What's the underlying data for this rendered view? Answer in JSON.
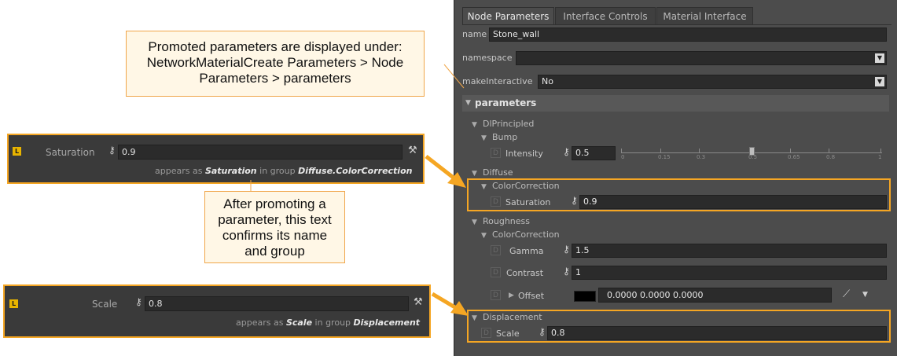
{
  "tabs": [
    "Node Parameters",
    "Interface Controls",
    "Material Interface"
  ],
  "name_field": {
    "label": "name",
    "value": "Stone_wall"
  },
  "namespace_field": {
    "label": "namespace",
    "value": ""
  },
  "make_interactive": {
    "label": "makeInteractive",
    "value": "No"
  },
  "section_title": "parameters",
  "tree": {
    "dlprincipled": "DlPrincipled",
    "bump": "Bump",
    "intensity": {
      "label": "Intensity",
      "value": "0.5"
    },
    "slider_ticks": [
      "0",
      "0.15",
      "0.3",
      "0.5",
      "0.65",
      "0.8",
      "1"
    ],
    "slider_value": 0.5,
    "diffuse": "Diffuse",
    "diffuse_cc": "ColorCorrection",
    "saturation": {
      "label": "Saturation",
      "value": "0.9"
    },
    "roughness": "Roughness",
    "roughness_cc": "ColorCorrection",
    "gamma": {
      "label": "Gamma",
      "value": "1.5"
    },
    "contrast": {
      "label": "Contrast",
      "value": "1"
    },
    "offset": {
      "label": "Offset",
      "value": "0.0000  0.0000  0.0000",
      "swatch": "#000000"
    },
    "displacement": "Displacement",
    "scale": {
      "label": "Scale",
      "value": "0.8"
    }
  },
  "left_bar_1": {
    "icon": "L",
    "label": "Saturation",
    "value": "0.9",
    "appears_prefix": "appears as",
    "appears_name": "Saturation",
    "appears_mid": "in group",
    "appears_group": "Diffuse.ColorCorrection"
  },
  "left_bar_2": {
    "icon": "L",
    "label": "Scale",
    "value": "0.8",
    "appears_prefix": "appears as",
    "appears_name": "Scale",
    "appears_mid": "in group",
    "appears_group": "Displacement"
  },
  "callout_top": [
    "Promoted parameters are displayed under:",
    "NetworkMaterialCreate Parameters > Node",
    "Parameters > parameters"
  ],
  "callout_mid": [
    "After promoting a",
    "parameter, this text",
    "confirms its name",
    "and group"
  ],
  "colors": {
    "accent": "#f5a623",
    "panel": "#4c4c4c",
    "field": "#2b2b2b"
  }
}
